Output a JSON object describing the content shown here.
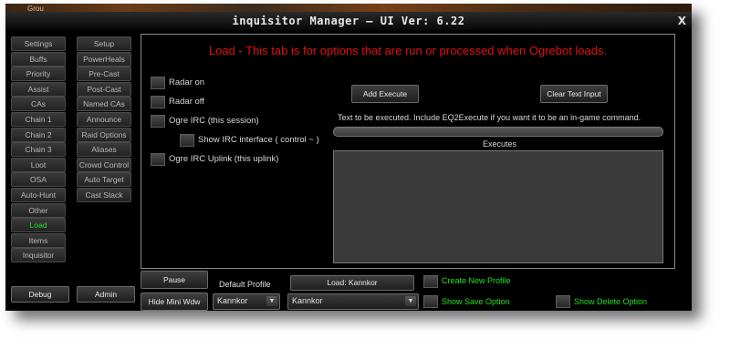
{
  "background_strip": {
    "label": "Grou"
  },
  "window": {
    "title": "inquisitor Manager  — UI Ver: 6.22",
    "close_label": "X"
  },
  "nav_left": [
    {
      "label": "Settings"
    },
    {
      "label": "Buffs"
    },
    {
      "label": "Priority"
    },
    {
      "label": "Assist"
    },
    {
      "label": "CAs"
    },
    {
      "label": "Chain 1"
    },
    {
      "label": "Chain 2"
    },
    {
      "label": "Chain 3"
    },
    {
      "label": "Loot"
    },
    {
      "label": "OSA"
    },
    {
      "label": "Auto-Hunt"
    },
    {
      "label": "Other"
    },
    {
      "label": "Load",
      "active": true
    },
    {
      "label": "Items"
    },
    {
      "label": "Inquisitor"
    }
  ],
  "nav_right": [
    {
      "label": "Setup"
    },
    {
      "label": "PowerHeals"
    },
    {
      "label": "Pre-Cast"
    },
    {
      "label": "Post-Cast"
    },
    {
      "label": "Named CAs"
    },
    {
      "label": "Announce"
    },
    {
      "label": "Raid Options"
    },
    {
      "label": "Aliases"
    },
    {
      "label": "Crowd Control"
    },
    {
      "label": "Auto Target"
    },
    {
      "label": "Cast Stack"
    }
  ],
  "panel": {
    "title": "Load - This tab is for options that are run or processed when Ogrebot loads.",
    "options": {
      "radar_on": "Radar on",
      "radar_off": "Radar off",
      "ogre_irc": "Ogre IRC (this session)",
      "show_irc": "Show IRC interface ( control ~ )",
      "irc_uplink": "Ogre IRC Uplink (this uplink)"
    },
    "add_execute": "Add Execute",
    "clear_text": "Clear Text Input",
    "exec_description": "Text to be executed. Include EQ2Execute if you want it to be an in-game command.",
    "exec_input_value": "",
    "executes_label": "Executes"
  },
  "bottom": {
    "debug": "Debug",
    "admin": "Admin",
    "pause": "Pause",
    "hide_mini": "Hide Mini Wdw",
    "default_profile_label": "Default Profile",
    "load_button": "Load: Kannkor",
    "create_new_profile": "Create New Profile",
    "profile_select_left": "Kannkor",
    "profile_select_right": "Kannkor",
    "show_save": "Show Save Option",
    "show_delete": "Show Delete Option"
  },
  "colors": {
    "accent_green": "#21e321",
    "panel_title_red": "#e01010"
  }
}
